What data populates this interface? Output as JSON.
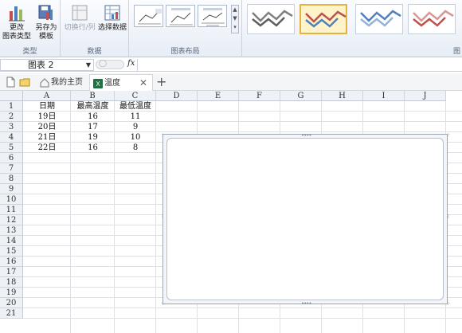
{
  "ribbon": {
    "type_group": {
      "label": "类型",
      "change_type": [
        "更改",
        "图表类型"
      ],
      "save_template": [
        "另存为",
        "模板"
      ]
    },
    "data_group": {
      "label": "数据",
      "switch_row_col": "切换行/列",
      "select_data": "选择数据"
    },
    "layout_group": {
      "label": "图表布局"
    },
    "style_group": {
      "styles": [
        {
          "name": "gray",
          "color": "#7f7f7f"
        },
        {
          "name": "red",
          "color": "#c0504d",
          "selected": true
        },
        {
          "name": "blue",
          "color": "#4f81bd"
        },
        {
          "name": "pink",
          "color": "#d99694"
        }
      ]
    },
    "right_label": "图"
  },
  "formula_bar": {
    "name_box": "图表 2",
    "fx": "fx",
    "formula": ""
  },
  "tabs": [
    {
      "label": "我的主页",
      "icon": "home-icon"
    },
    {
      "label": "温度",
      "icon": "excel-icon",
      "active": true
    }
  ],
  "sheet": {
    "columns": [
      "A",
      "B",
      "C",
      "D",
      "E",
      "F",
      "G",
      "H",
      "I",
      "J"
    ],
    "rows": [
      "1",
      "2",
      "3",
      "4",
      "5",
      "6",
      "7",
      "8",
      "9",
      "10",
      "11",
      "12",
      "13",
      "14",
      "15",
      "16",
      "17",
      "18",
      "19",
      "20",
      "21"
    ],
    "data": [
      [
        "日期",
        "最高温度",
        "最低温度"
      ],
      [
        "19日",
        "16",
        "11"
      ],
      [
        "20日",
        "17",
        "9"
      ],
      [
        "21日",
        "19",
        "10"
      ],
      [
        "22日",
        "16",
        "8"
      ]
    ]
  }
}
